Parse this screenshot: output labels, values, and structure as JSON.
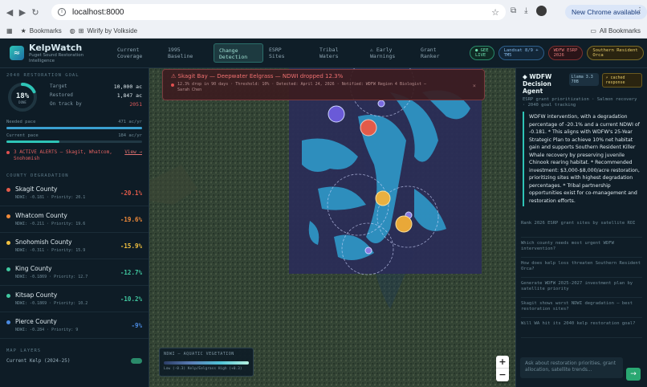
{
  "browser": {
    "url": "localhost:8000",
    "update_label": "New Chrome available",
    "bookmarks": [
      "Bookmarks",
      "Wirify by Volkside"
    ],
    "all_bookmarks": "All Bookmarks"
  },
  "app": {
    "name": "KelpWatch",
    "tagline_1": "Puget Sound Restoration",
    "tagline_2": "Intelligence",
    "tabs": [
      {
        "l1": "Current",
        "l2": "Coverage"
      },
      {
        "l1": "1995",
        "l2": "Baseline"
      },
      {
        "l1": "Change",
        "l2": "Detection"
      },
      {
        "l1": "ESRP",
        "l2": "Sites"
      },
      {
        "l1": "Tribal",
        "l2": "Waters"
      },
      {
        "l1": "⚠ Early",
        "l2": "Warnings"
      },
      {
        "l1": "Grant",
        "l2": "Ranker"
      }
    ],
    "pills": [
      {
        "l1": "● GEE",
        "l2": "LIVE"
      },
      {
        "l1": "Landsat 8/9 +",
        "l2": "TM5"
      },
      {
        "l1": "WDFW ESRP",
        "l2": "2026"
      },
      {
        "l1": "Southern Resident",
        "l2": "Orca"
      }
    ]
  },
  "sidebar": {
    "goal_title": "2040 RESTORATION GOAL",
    "goal_pct": "18%",
    "goal_sub": "DONE",
    "goal_fraction": 0.18,
    "target_label": "Target",
    "target_value": "10,000 ac",
    "restored_label": "Restored",
    "restored_value": "1,847 ac",
    "ontrack_label": "On track by",
    "ontrack_value": "2051",
    "needed_label": "Needed pace",
    "needed_value": "471 ac/yr",
    "current_label": "Current pace",
    "current_value": "184 ac/yr",
    "current_fraction": 0.39,
    "alert_text": "3 ACTIVE ALERTS — Skagit, Whatcom, Snohomish",
    "alert_link": "View →",
    "degradation_title": "COUNTY DEGRADATION",
    "counties": [
      {
        "name": "Skagit County",
        "meta": "NDWI: -0.181 · Priority: 20.1",
        "pct": "-20.1%",
        "color": "#e35b4a"
      },
      {
        "name": "Whatcom County",
        "meta": "NDWI: -0.211 · Priority: 19.6",
        "pct": "-19.6%",
        "color": "#f08a3a"
      },
      {
        "name": "Snohomish County",
        "meta": "NDWI: -0.311 · Priority: 15.9",
        "pct": "-15.9%",
        "color": "#f0c040"
      },
      {
        "name": "King County",
        "meta": "NDWI: -0.1869 · Priority: 12.7",
        "pct": "-12.7%",
        "color": "#40c8a0"
      },
      {
        "name": "Kitsap County",
        "meta": "NDWI: -0.1869 · Priority: 10.2",
        "pct": "-10.2%",
        "color": "#40c8a0"
      },
      {
        "name": "Pierce County",
        "meta": "NDWI: -0.284 · Priority: 9",
        "pct": "-9%",
        "color": "#4a8ae0"
      }
    ],
    "map_layers_title": "MAP LAYERS",
    "layer_partial": "Current Kelp (2024-25)"
  },
  "alert_banner": {
    "title": "⚠ Skagit Bay — Deepwater Eelgrass — NDWI dropped 12.3%",
    "line1": "12.3% drop in 90 days · Threshold: 10% · Detected: April 24, 2026 · Notified: WDFW Region 4 Biologist —",
    "line2": "Sarah Chen",
    "close": "×"
  },
  "legend": {
    "title": "NDWI — AQUATIC VEGETATION",
    "low": "Low (-0.3)",
    "mid": "Kelp/Eelgrass",
    "high": "High (+0.3)"
  },
  "zoom": {
    "plus": "+",
    "minus": "−"
  },
  "agent": {
    "title_1": "WDFW",
    "title_2": "Decision Agent",
    "model": "Llama 3.3 70B",
    "cached": "⚡ cached response",
    "subtitle": "ESRP grant prioritization · Salmon recovery · 2040 goal tracking",
    "answer": "WDFW intervention, with a degradation percentage of -20.1% and a current NDWI of -0.181. * This aligns with WDFW's 25-Year Strategic Plan to achieve 10% net habitat gain and supports Southern Resident Killer Whale recovery by preserving juvenile Chinook rearing habitat. * Recommended investment: $3,000-$8,000/acre restoration, prioritizing sites with highest degradation percentages. * Tribal partnership opportunities exist for co-management and restoration efforts.",
    "suggestions": [
      "Rank 2026 ESRP grant sites by satellite ROI",
      "Which county needs most urgent WDFW intervention?",
      "How does kelp loss threaten Southern Resident Orca?",
      "Generate WDFW 2025-2027 investment plan by satellite priority",
      "Skagit shows worst NDWI degradation — best restoration sites?",
      "Will WA hit its 2040 kelp restoration goal?"
    ],
    "ask_placeholder": "Ask about restoration priorities, grant allocation, satellite trends...",
    "send": "→"
  }
}
